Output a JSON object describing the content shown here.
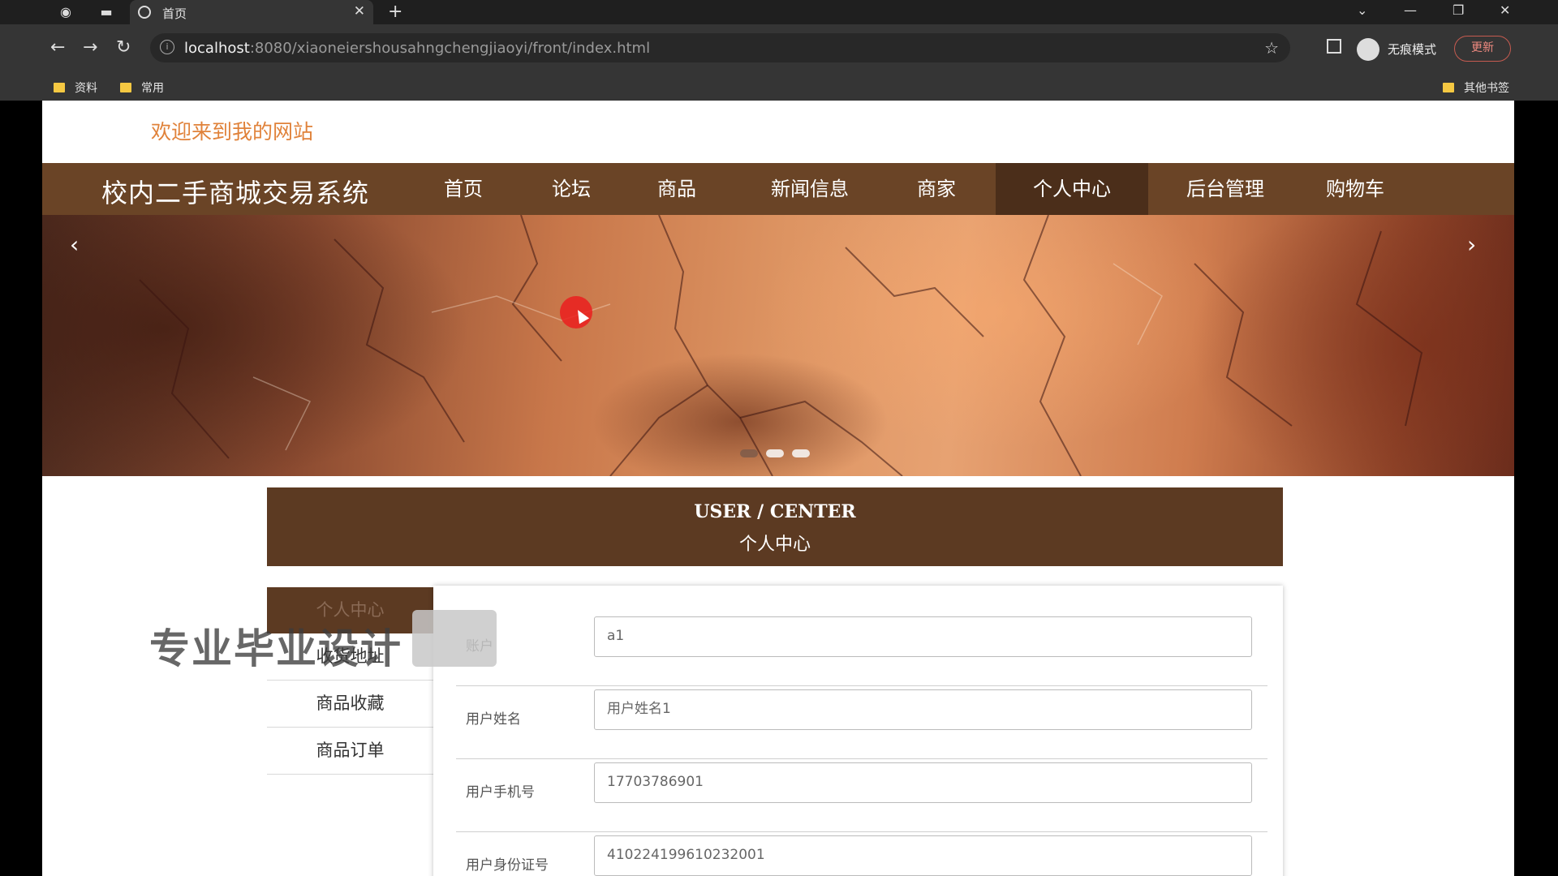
{
  "browser": {
    "tab_title": "首页",
    "url_host": "localhost",
    "url_rest": ":8080/xiaoneiershousahngchengjiaoyi/front/index.html",
    "incognito_label": "无痕模式",
    "update_label": "更新",
    "bookmarks": [
      "资料",
      "常用"
    ],
    "other_bookmarks": "其他书签"
  },
  "page": {
    "welcome": "欢迎来到我的网站",
    "site_title": "校内二手商城交易系统",
    "nav": [
      "首页",
      "论坛",
      "商品",
      "新闻信息",
      "商家",
      "个人中心",
      "后台管理",
      "购物车"
    ],
    "active_nav": "个人中心",
    "banner": {
      "slides": 3,
      "active_slide": 1
    },
    "section": {
      "en": "USER / CENTER",
      "cn": "个人中心"
    },
    "side_menu": [
      "个人中心",
      "收货地址",
      "商品收藏",
      "商品订单"
    ],
    "form": [
      {
        "label": "账户",
        "value": "a1"
      },
      {
        "label": "用户姓名",
        "value": "用户姓名1"
      },
      {
        "label": "用户手机号",
        "value": "17703786901"
      },
      {
        "label": "用户身份证号",
        "value": "410224199610232001"
      }
    ],
    "watermark": "专业毕业设计"
  },
  "colors": {
    "nav_bg": "#6a4426",
    "nav_active": "#4b2e1a",
    "section_bg": "#5c3a22",
    "welcome_text": "#e0823a"
  }
}
